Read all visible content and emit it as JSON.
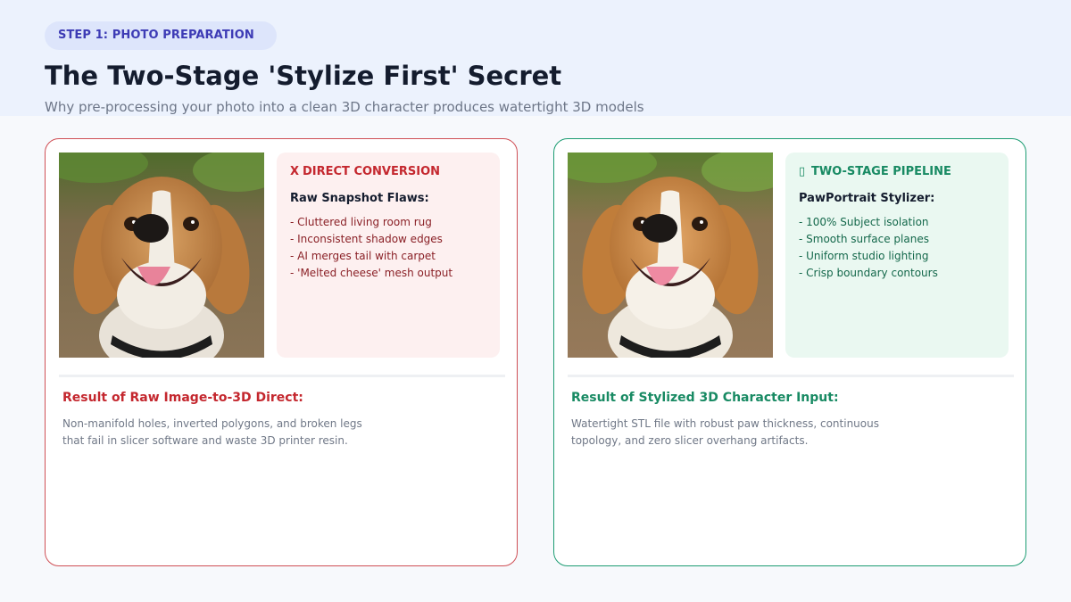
{
  "header": {
    "step_label": "STEP 1: PHOTO PREPARATION",
    "title": "The Two-Stage 'Stylize First' Secret",
    "subtitle": "Why pre-processing your photo into a clean 3D character produces watertight 3D models"
  },
  "colors": {
    "accent": "#3d3bb5",
    "bad": "#c4272e",
    "good": "#188a63"
  },
  "left_card": {
    "photo_alt": "beagle-photo-raw",
    "head_icon": "X",
    "head_icon_name": "x-icon",
    "heading": "DIRECT CONVERSION",
    "subheading": "Raw Snapshot Flaws:",
    "items": [
      "- Cluttered living room rug",
      "- Inconsistent shadow edges",
      "- AI merges tail with carpet",
      "- 'Melted cheese' mesh output"
    ],
    "result_title": "Result of Raw Image-to-3D Direct:",
    "result_text": "Non-manifold holes, inverted polygons, and broken legs that fail in slicer software and waste 3D printer resin."
  },
  "right_card": {
    "photo_alt": "beagle-photo-stylized",
    "head_icon": "▯",
    "head_icon_name": "missing-glyph-icon",
    "heading": "TWO-STAGE PIPELINE",
    "subheading": "PawPortrait Stylizer:",
    "items": [
      "- 100% Subject isolation",
      "- Smooth surface planes",
      "- Uniform studio lighting",
      "- Crisp boundary contours"
    ],
    "result_title": "Result of Stylized 3D Character Input:",
    "result_text": "Watertight STL file with robust paw thickness, continuous topology, and zero slicer overhang artifacts."
  }
}
